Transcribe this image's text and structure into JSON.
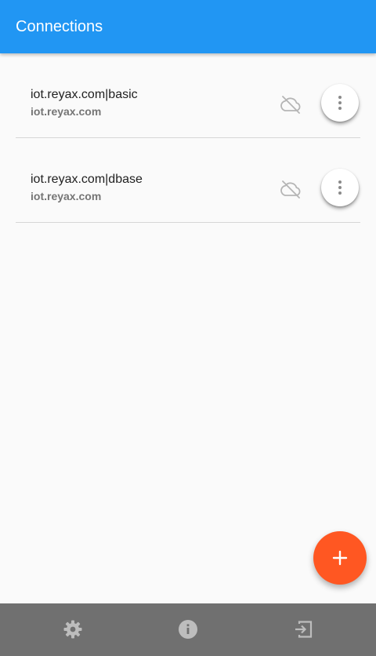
{
  "appbar": {
    "title": "Connections"
  },
  "connections": [
    {
      "name": "iot.reyax.com|basic",
      "host": "iot.reyax.com",
      "status_icon": "cloud-off-icon"
    },
    {
      "name": "iot.reyax.com|dbase",
      "host": "iot.reyax.com",
      "status_icon": "cloud-off-icon"
    }
  ],
  "fab": {
    "icon": "plus-icon"
  },
  "bottom_nav": [
    {
      "icon": "settings-gear-icon"
    },
    {
      "icon": "info-icon"
    },
    {
      "icon": "exit-icon"
    }
  ],
  "colors": {
    "primary": "#2196f3",
    "accent": "#ff5722",
    "bottom_bar": "#707070",
    "background": "#fafafa"
  }
}
